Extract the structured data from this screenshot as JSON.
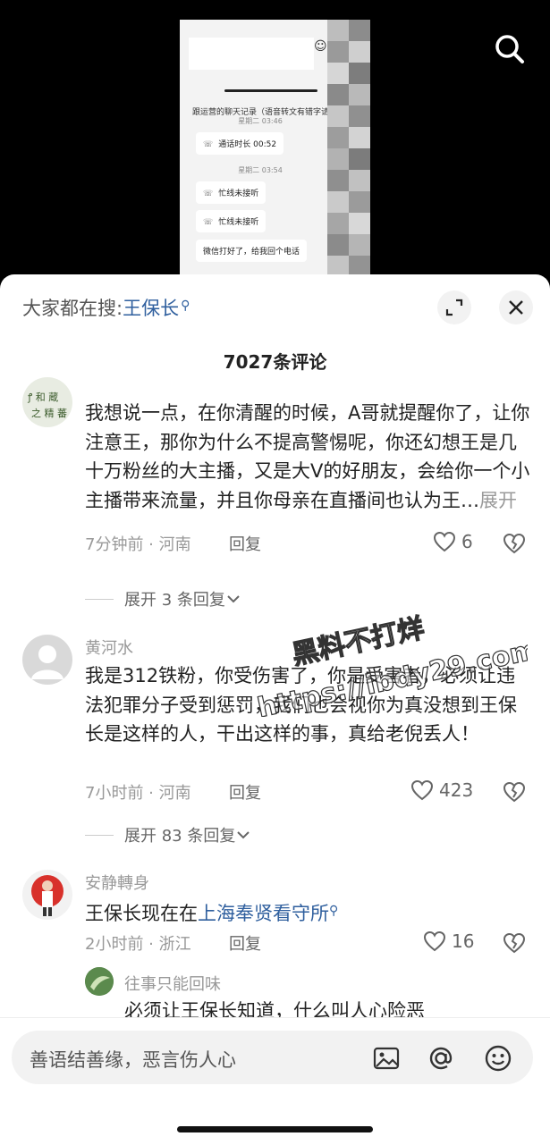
{
  "video": {
    "chat_caption": "跟运营的聊天记录（语音转文有错字请",
    "timestamps": [
      "星期二 03:46",
      "星期二 03:54"
    ],
    "bubbles": [
      "通话时长 00:52",
      "忙线未接听",
      "忙线未接听",
      "微信打好了，给我回个电话"
    ],
    "search_icon": "search-icon"
  },
  "panel": {
    "search_prefix": "大家都在搜:",
    "search_keyword": "王保长",
    "comment_count": "7027条评论",
    "expand_icon": "expand-icon",
    "close_icon": "close-icon"
  },
  "comments": [
    {
      "username": "",
      "text": "我想说一点，在你清醒的时候，A哥就提醒你了，让你注意王，那你为什么不提高警惕呢，你还幻想王是几十万粉丝的大主播，又是大V的好朋友，会给你一个小主播带来流量，并且你母亲在直播间也认为王…",
      "more": "展开",
      "meta": "7分钟前 · 河南",
      "reply": "回复",
      "likes": "6",
      "expand": "展开 3 条回复"
    },
    {
      "username": "黄河水",
      "text": "我是312铁粉，你受伤害了，你是受害者，必须让违法犯罪分子受到惩罚，我们也会视你为真没想到王保长是这样的人，干出这样的事，真给老倪丢人！",
      "meta": "7小时前 · 河南",
      "reply": "回复",
      "likes": "423",
      "expand": "展开 83 条回复"
    },
    {
      "username": "安静轉身",
      "text_prefix": "王保长现在在",
      "text_link": "上海奉贤看守所",
      "meta": "2小时前 · 浙江",
      "reply": "回复",
      "likes": "16"
    },
    {
      "username": "往事只能回味",
      "text": "必须让王保长知道，什么叫人心险恶"
    }
  ],
  "bottom": {
    "placeholder": "善语结善缘，恶言伤人心",
    "icons": [
      "image-icon",
      "at-icon",
      "emoji-icon"
    ]
  }
}
